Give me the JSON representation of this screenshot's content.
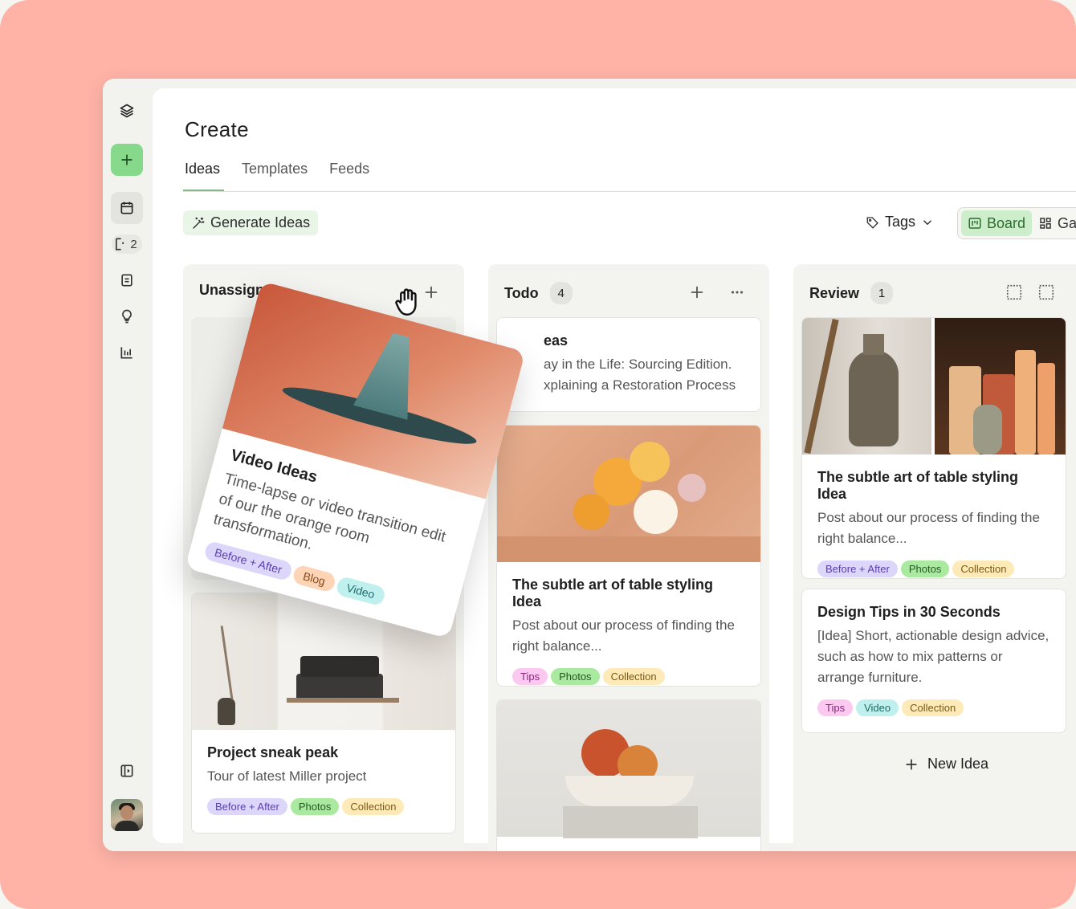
{
  "page": {
    "title": "Create"
  },
  "tabs": [
    {
      "label": "Ideas",
      "active": true
    },
    {
      "label": "Templates",
      "active": false
    },
    {
      "label": "Feeds",
      "active": false
    }
  ],
  "sidebar": {
    "badge_count": "2",
    "icons": [
      "layers-icon",
      "plus-icon",
      "calendar-icon",
      "drafts-icon",
      "document-icon",
      "lightbulb-icon",
      "analytics-icon",
      "collapse-sidebar-icon"
    ]
  },
  "toolbar": {
    "generate_label": "Generate Ideas",
    "tags_label": "Tags",
    "board_label": "Board",
    "gallery_label": "Ga"
  },
  "columns": [
    {
      "name": "Unassign",
      "cards": [
        {
          "title": "Project sneak peak",
          "text": "Tour of latest Miller project",
          "tags": [
            "Before + After",
            "Photos",
            "Collection"
          ]
        }
      ]
    },
    {
      "name": "Todo",
      "count": "4",
      "cards": [
        {
          "title": "eas",
          "text_line1": "ay in the Life: Sourcing Edition.",
          "text_line2": "xplaining a Restoration Process"
        },
        {
          "title": "The subtle art of table styling Idea",
          "text": "Post about our process of finding the right balance...",
          "tags": [
            "Tips",
            "Photos",
            "Collection"
          ]
        }
      ]
    },
    {
      "name": "Review",
      "count": "1",
      "cards": [
        {
          "title": "The subtle art of table styling Idea",
          "text": "Post about our process of finding the right balance...",
          "tags": [
            "Before + After",
            "Photos",
            "Collection"
          ]
        },
        {
          "title": "Design Tips in 30 Seconds",
          "text": "[Idea] Short, actionable design advice, such as how to mix patterns or arrange furniture.",
          "tags": [
            "Tips",
            "Video",
            "Collection"
          ]
        }
      ],
      "new_idea_label": "New Idea"
    }
  ],
  "dragged_card": {
    "title": "Video Ideas",
    "text": "Time-lapse or video transition edit of our the orange room transformation.",
    "tags": [
      "Before + After",
      "Blog",
      "Video"
    ]
  },
  "colors": {
    "background": "#ffb3a7",
    "accent_green": "#86d98a",
    "board_active": "#cdeecb"
  }
}
